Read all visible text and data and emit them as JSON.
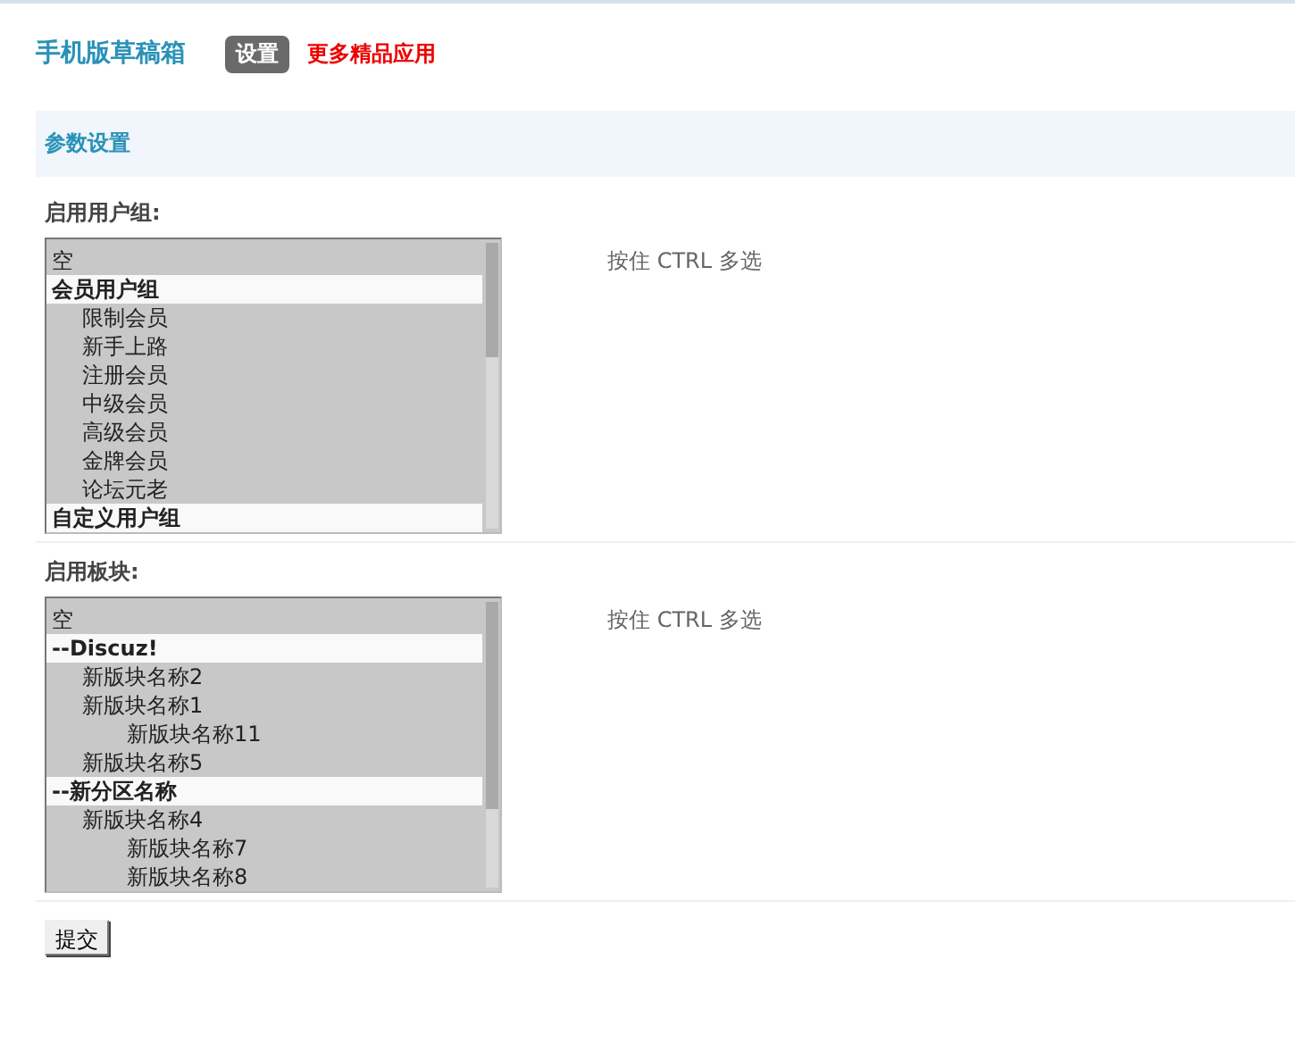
{
  "header": {
    "title": "手机版草稿箱",
    "tabs": [
      {
        "label": "设置",
        "selected": true
      }
    ],
    "link": "更多精品应用"
  },
  "section": {
    "title": "参数设置"
  },
  "fields": [
    {
      "label": "启用用户组:",
      "hint": "按住 CTRL 多选",
      "items": [
        {
          "kind": "option",
          "label": "空",
          "selected": true
        },
        {
          "kind": "group",
          "label": "会员用户组",
          "children": [
            {
              "kind": "option",
              "label": "限制会员",
              "selected": true
            },
            {
              "kind": "option",
              "label": "新手上路",
              "selected": true
            },
            {
              "kind": "option",
              "label": "注册会员",
              "selected": true
            },
            {
              "kind": "option",
              "label": "中级会员",
              "selected": true
            },
            {
              "kind": "option",
              "label": "高级会员",
              "selected": true
            },
            {
              "kind": "option",
              "label": "金牌会员",
              "selected": true
            },
            {
              "kind": "option",
              "label": "论坛元老",
              "selected": true
            }
          ]
        },
        {
          "kind": "group",
          "label": "自定义用户组"
        }
      ]
    },
    {
      "label": "启用板块:",
      "hint": "按住 CTRL 多选",
      "items": [
        {
          "kind": "option",
          "label": "空",
          "selected": true
        },
        {
          "kind": "group",
          "label": "--Discuz!",
          "children": [
            {
              "kind": "option",
              "label": "新版块名称2",
              "selected": true
            },
            {
              "kind": "option",
              "label": "新版块名称1",
              "selected": true,
              "children": [
                {
                  "kind": "option",
                  "label": "新版块名称11",
                  "selected": true
                }
              ]
            },
            {
              "kind": "option",
              "label": "新版块名称5",
              "selected": true
            }
          ]
        },
        {
          "kind": "group",
          "label": "--新分区名称",
          "children": [
            {
              "kind": "option",
              "label": "新版块名称4",
              "selected": true,
              "children": [
                {
                  "kind": "option",
                  "label": "新版块名称7",
                  "selected": true
                },
                {
                  "kind": "option",
                  "label": "新版块名称8",
                  "selected": true
                }
              ]
            }
          ]
        }
      ]
    }
  ],
  "submit": "提交"
}
